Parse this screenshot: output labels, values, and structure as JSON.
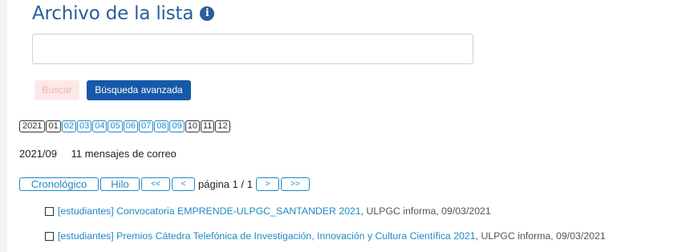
{
  "header": {
    "title": "Archivo de la lista"
  },
  "search": {
    "placeholder": "",
    "value": "",
    "search_label": "Buscar",
    "advanced_label": "Búsqueda avanzada"
  },
  "months": {
    "year": "2021",
    "items": [
      {
        "label": "01",
        "linked": false
      },
      {
        "label": "02",
        "linked": true
      },
      {
        "label": "03",
        "linked": true
      },
      {
        "label": "04",
        "linked": true
      },
      {
        "label": "05",
        "linked": true
      },
      {
        "label": "06",
        "linked": true
      },
      {
        "label": "07",
        "linked": true
      },
      {
        "label": "08",
        "linked": true
      },
      {
        "label": "09",
        "linked": true
      },
      {
        "label": "10",
        "linked": false
      },
      {
        "label": "11",
        "linked": false
      },
      {
        "label": "12",
        "linked": false
      }
    ]
  },
  "summary": {
    "period": "2021/09",
    "count": "11 mensajes de correo"
  },
  "pager": {
    "chronological": "Cronológico",
    "thread": "Hilo",
    "first": "<<",
    "prev": "<",
    "page_text": "página 1 / 1",
    "next": ">",
    "last": ">>"
  },
  "messages": [
    {
      "subject": "[estudiantes] Convocatoria EMPRENDE-ULPGC_SANTANDER 2021",
      "meta": ", ULPGC informa, 09/03/2021"
    },
    {
      "subject": "[estudiantes] Premios Cátedra Telefónica de Investigación, Innovación y Cultura Científica 2021",
      "meta": ", ULPGC informa, 09/03/2021"
    }
  ],
  "colors": {
    "accent": "#1659a8",
    "link": "#1f8ac7",
    "title": "#2a5d9a"
  },
  "icons": {
    "info": "info-circle-icon"
  }
}
